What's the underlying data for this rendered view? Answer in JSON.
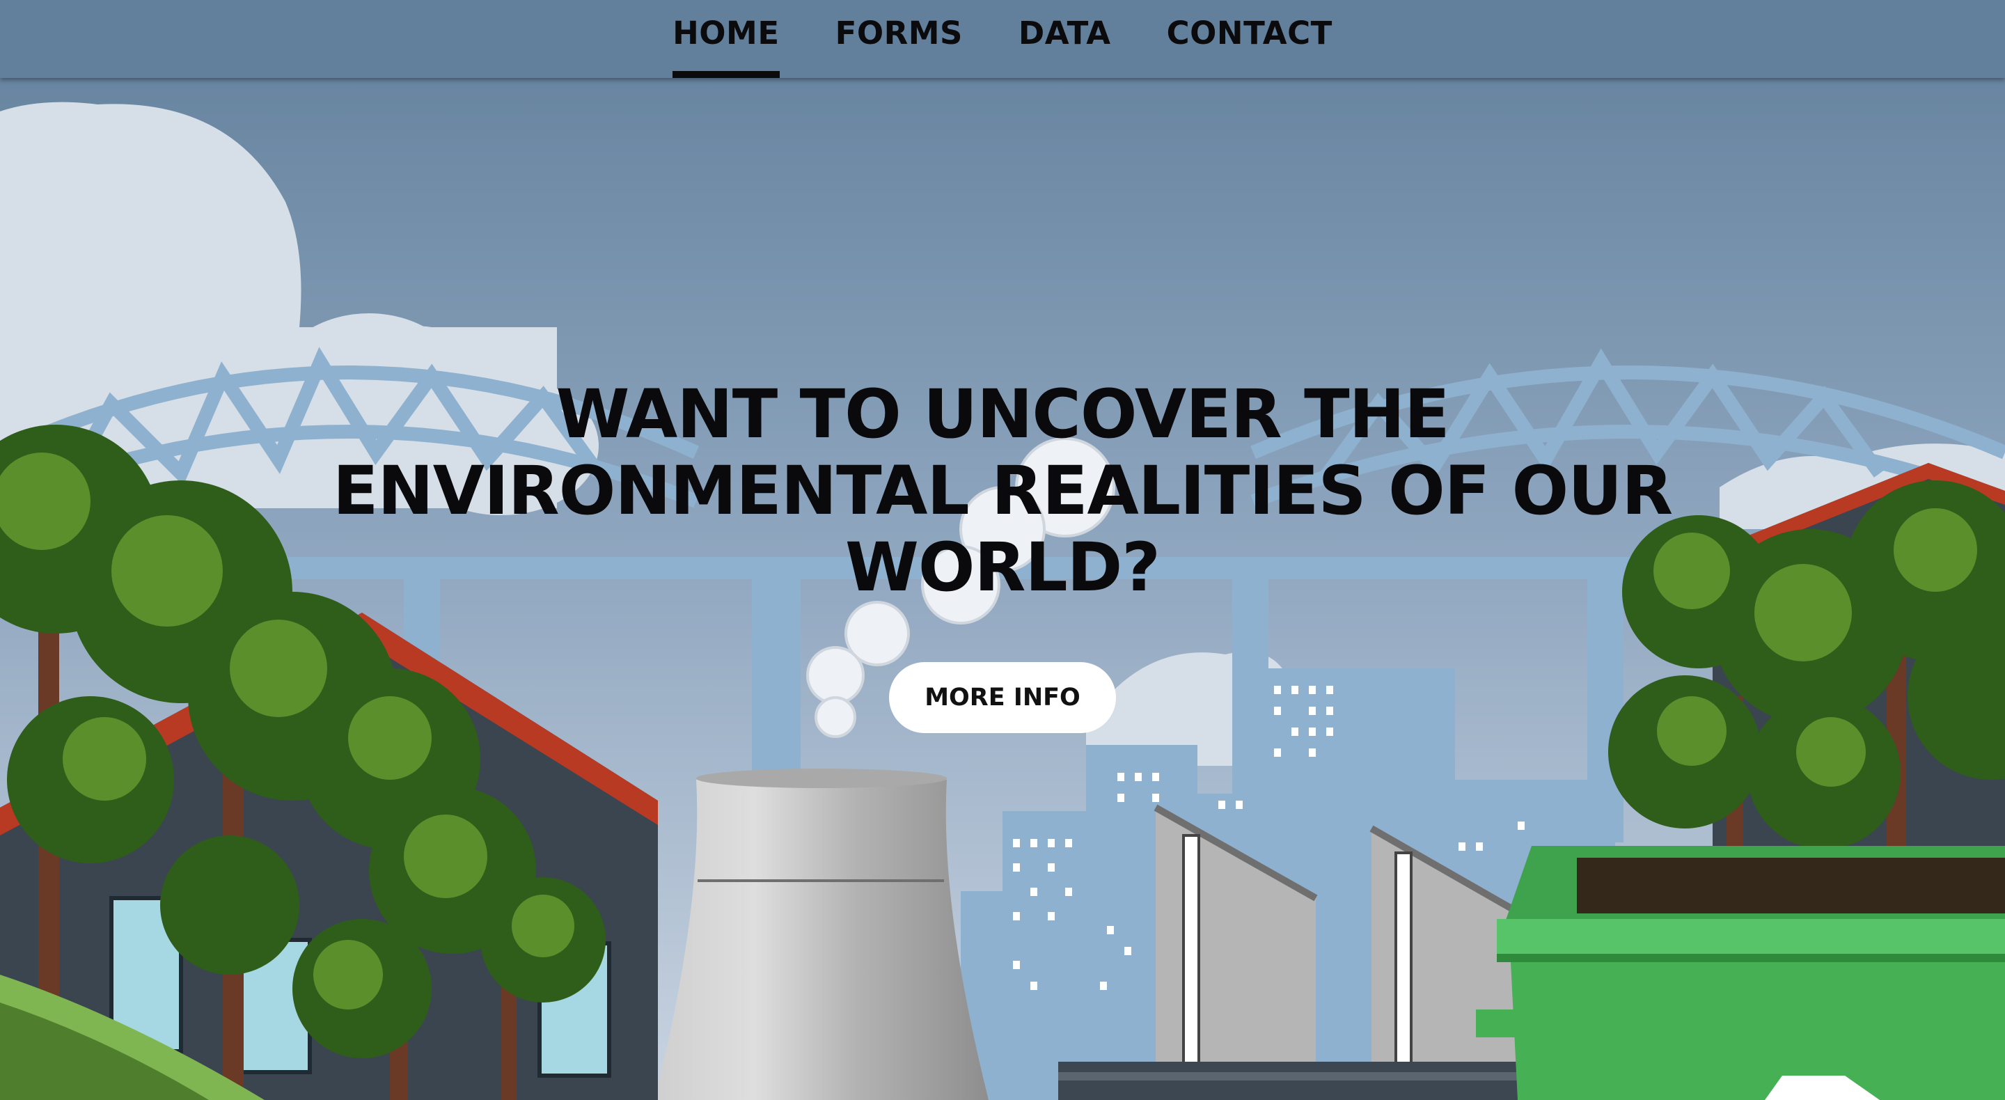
{
  "nav": {
    "items": [
      {
        "label": "HOME",
        "active": true
      },
      {
        "label": "FORMS",
        "active": false
      },
      {
        "label": "DATA",
        "active": false
      },
      {
        "label": "CONTACT",
        "active": false
      }
    ]
  },
  "hero": {
    "title_line1": "WANT TO UNCOVER THE",
    "title_line2": "ENVIRONMENTAL REALITIES OF OUR",
    "title_line3": "WORLD?",
    "cta_label": "MORE INFO"
  },
  "colors": {
    "nav_bg": "#62809c",
    "sky_top": "#62809c",
    "sky_bottom": "#b7c6d8",
    "bridge": "#8eb1cf",
    "city": "#8eb1cf",
    "roof": "#b83a23",
    "building": "#3a4550",
    "tree_dark": "#2f5d1a",
    "tree_light": "#5b8f2c",
    "bin": "#45b054",
    "cooling_tower": "#b9b9b9"
  }
}
